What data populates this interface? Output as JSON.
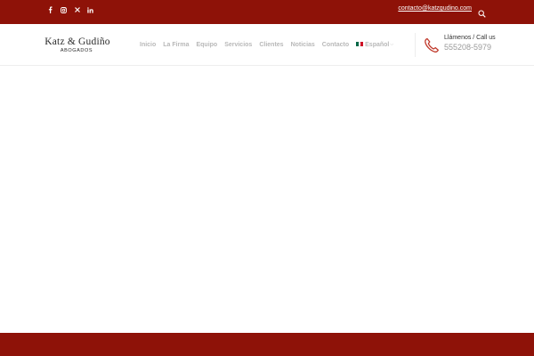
{
  "colors": {
    "brand_red": "#8e1208",
    "nav_text": "#b8b8b8",
    "flag_green": "#006847",
    "flag_red": "#ce1126"
  },
  "topbar": {
    "social": [
      {
        "name": "facebook-icon",
        "glyph": "f"
      },
      {
        "name": "instagram-icon",
        "glyph": "ig"
      },
      {
        "name": "x-icon",
        "glyph": "✕"
      },
      {
        "name": "linkedin-icon",
        "glyph": "in"
      }
    ],
    "email": "contacto@katzgudino.com",
    "search_icon": "search-icon"
  },
  "header": {
    "logo": {
      "name": "Katz & Gudiño",
      "sub": "ABOGADOS"
    },
    "nav": [
      "Inicio",
      "La Firma",
      "Equipo",
      "Servicios",
      "Clientes",
      "Noticias",
      "Contacto"
    ],
    "language": {
      "label": "Español",
      "flag": "mexico-flag-icon"
    },
    "call": {
      "label": "Llámenos / Call us",
      "number": "555208-5979",
      "icon": "phone-icon"
    }
  }
}
